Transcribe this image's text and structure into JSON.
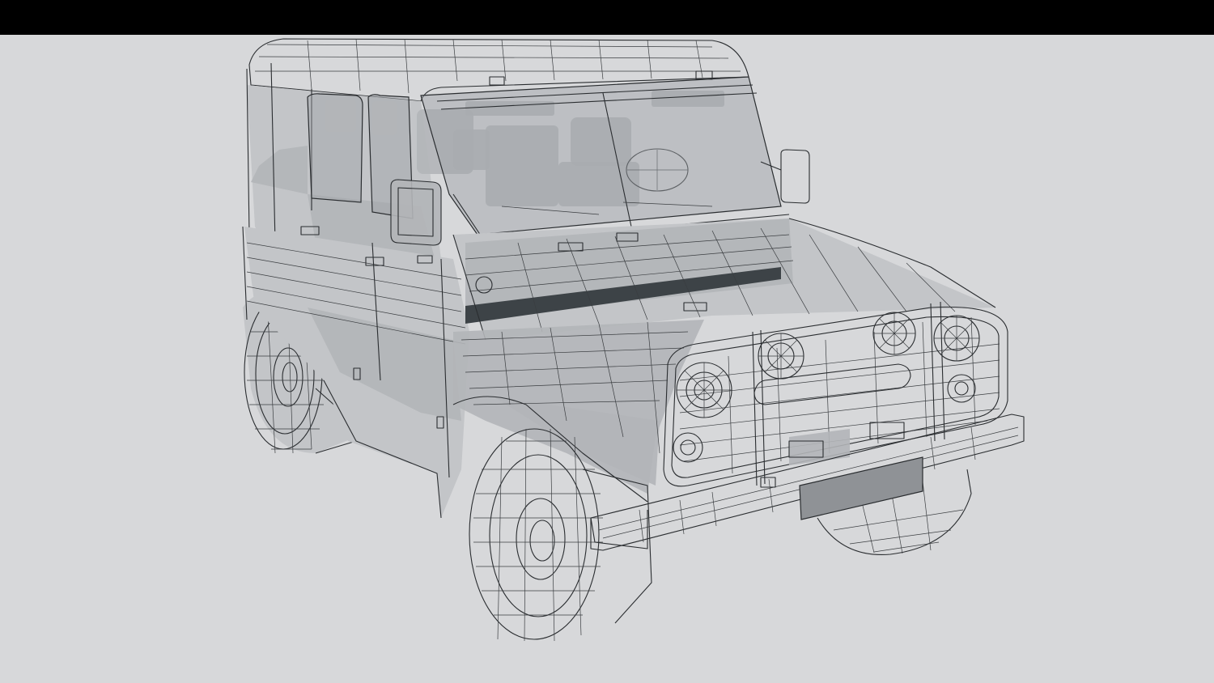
{
  "window": {
    "top_bar_color": "#000000",
    "viewport_background": "#d7d8da"
  },
  "scene": {
    "subject": "vehicle-wireframe-model",
    "render_style": "wireframe-with-translucent-shading",
    "wire_color": "#2a2d30",
    "shade_color": "#b3b5b8",
    "accent_stripe_color": "#3d4347",
    "plate_color": "#8f9296"
  }
}
